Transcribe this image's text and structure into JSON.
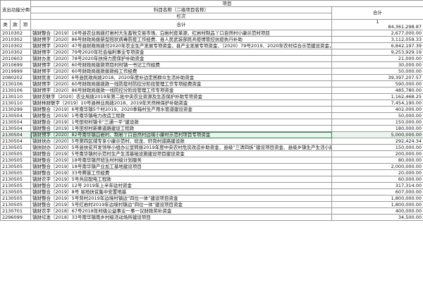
{
  "header": {
    "left_title": "支出功能分类科目编码",
    "project_group": "项目",
    "project_name_col": "科目名称（二级项目名称）",
    "total_col": "合计",
    "col_class": "类",
    "col_item": "款",
    "col_sub": "项",
    "seq_label": "栏次",
    "seq_value": "1",
    "total_row_label": "合计",
    "total_row_value": "84,361,298.87"
  },
  "rows": [
    {
      "code": "2010302",
      "name": "镇财整合〔2019〕16号县农业局拨打岩村大生畜牧交易市场、白岩村皮革源、红岩村制品丫口自然村小康示范村项目",
      "amount": "2,677,000.00"
    },
    {
      "code": "2010302",
      "name": "镇财预字〔2020〕86号财政局拨新型冠状病毒防疫工作经费、县人民武装部民兵疫情管控抗疫执行补助",
      "amount": "3,112,059.33"
    },
    {
      "code": "2010302",
      "name": "镇财预字〔2020〕47号县财政局拨付2020年农业生产发展专项资金，县产业发展专项资金、（2020）79号2019、2020年农村综合示范建设资金，县扶贫项目建设用地支持资金补助",
      "amount": "6,842,197.39"
    },
    {
      "code": "2010302",
      "name": "镇财预字〔2020〕79号2020年社会福利事业专项资金",
      "amount": "9,253,929.19"
    },
    {
      "code": "2010603",
      "name": "镇财办发〔2020〕78号2020年扶持力度保护补助资金",
      "amount": "21,000.00"
    },
    {
      "code": "2010699",
      "name": "镇财预字〔2020〕60号财政局拨款项目村村镇一书记工作经费",
      "amount": "30,000.00"
    },
    {
      "code": "2019999",
      "name": "镇财预字〔2020〕60号财政局拨款拨款经工作经费",
      "amount": "50,000.00"
    },
    {
      "code": "2080202",
      "name": "镇财民发〔2020〕6号县民政局拨2018、2020年度补边定居群众生活补助资金",
      "amount": "39,397,207.57"
    },
    {
      "code": "2130106",
      "name": "镇财预字〔2020〕60号财政局拨拨款一线防疫村防控分阶段管理工作专项经费资金",
      "amount": "590,000.00"
    },
    {
      "code": "2130106",
      "name": "镇财预字〔2020〕86号财政局拨款一线防控分阶段管理工作专项资金",
      "amount": "485,780.00"
    },
    {
      "code": "2130110",
      "name": "镇财农联字〔2020〕农业局拨2019年第二批中央农业资源及生态保护补助专项资金",
      "amount": "1,162,468.25"
    },
    {
      "code": "2130110",
      "name": "镇财林财联字〔2019〕10号县林业局拨2018、2019年天然林保护补助资金",
      "amount": "7,454,190.00"
    },
    {
      "code": "2130299",
      "name": "镇财整合〔2019〕6号南华镇5个村2019、2020季箱村生产用水管道建设资金",
      "amount": "402,000.00"
    },
    {
      "code": "2130504",
      "name": "镇财整合〔2019〕1号南华镇电力改造工程款",
      "amount": "50,000.00"
    },
    {
      "code": "2130504",
      "name": "镇财整合〔2019〕1号田坝村镇卡“三通一平”建设款",
      "amount": "150,000.00"
    },
    {
      "code": "2130504",
      "name": "镇财整合〔2019〕1号田坝村新寨道路建设工程款",
      "amount": "180,000.00"
    },
    {
      "code": "2130504",
      "name": "镇财预字〔2020〕82号南华镇白岩村、制岩丫口自然村边境小康村示范村项目专项资金",
      "amount": "5,000,000.00",
      "highlight": true
    },
    {
      "code": "2130504",
      "name": "镇财扶办〔2020〕5号第四区域专享小康示范村、班龙、轩岗村道路建设款",
      "amount": "292,424.34"
    },
    {
      "code": "2130505",
      "name": "镇扶财办〔2020〕5号县扶贫开发领导小组办公室转拨2019年度中央农村危房改造补助资金、县级“三清四拆”建设项目资金、县级乡镇生产生活小康建设资金",
      "amount": "150,000.00"
    },
    {
      "code": "2130505",
      "name": "镇财整合〔2019〕5号南华镇村示范村生产生活基础设施建设项目建设资金",
      "amount": "200,000.00"
    },
    {
      "code": "2130505",
      "name": "镇财整合〔2019〕18号南华镇开班生村村级计划服务",
      "amount": "80,000.00"
    },
    {
      "code": "2130505",
      "name": "镇财整合〔2019〕18号南华镇产业加工基地建设项目",
      "amount": "2,000,000.00"
    },
    {
      "code": "2130505",
      "name": "镇财整合〔2019〕33号腾苗工作经费",
      "amount": "20,000.00"
    },
    {
      "code": "2130505",
      "name": "镇财农字〔2019〕5号共房配电工程款",
      "amount": "60,000.00"
    },
    {
      "code": "2130505",
      "name": "镇财整合〔2019〕12号 2019年上半年驻村资金",
      "amount": "317,314.00"
    },
    {
      "code": "2130505",
      "name": "镇财整合〔2019〕8号 易地扶贫集中安置地基",
      "amount": "607,000.00"
    },
    {
      "code": "2130505",
      "name": "镇财整合〔2019〕5号背村2019年边境村镇边“四位一体”建设项目资金",
      "amount": "1,800,000.00"
    },
    {
      "code": "2130505",
      "name": "镇财整合〔2019〕5号红岩村2019年边境村镇边“四位一体”建设项目资金",
      "amount": "1,800,000.00"
    },
    {
      "code": "2130701",
      "name": "镇财农字〔2018〕67号2018年村级公益事业一事一议财政奖补资金",
      "amount": "400,000.00"
    },
    {
      "code": "2296099",
      "name": "镇财综发〔2018〕33号南华镇南乡村级活动场所建设项目",
      "amount": "34,500.00"
    }
  ]
}
